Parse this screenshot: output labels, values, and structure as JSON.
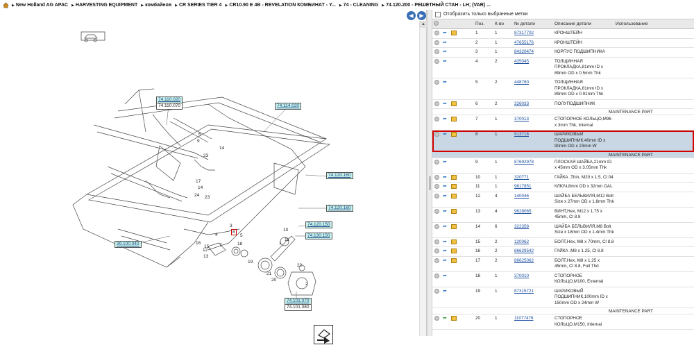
{
  "breadcrumb": [
    "New Holland AG APAC",
    "HARVESTING EQUIPMENT",
    "комбайнов",
    "CR SERIES TIER 4",
    "CR10.90 E 4B - REVELATION КОМБИНАТ - Y...",
    "74 - CLEANING",
    "74.120.200 - РЕШЕТНЫЙ СТАН - LH; (VAR) ..."
  ],
  "filter_label": "Отобразить только выбранные метки",
  "columns": {
    "pos": "Поз.",
    "qty": "К-во",
    "pn": "№ детали",
    "desc": "Описание детали",
    "use": "Использование"
  },
  "maintenance_label": "MAINTENANCE PART",
  "parts": [
    {
      "pos": "1",
      "qty": "1",
      "pn": "87317702",
      "desc": "КРОНШТЕЙН",
      "arrow": "blue",
      "box": true,
      "mp": false
    },
    {
      "pos": "2",
      "qty": "1",
      "pn": "47655176",
      "desc": "КРОНШТЕЙН",
      "arrow": "blue",
      "box": false,
      "mp": false
    },
    {
      "pos": "3",
      "qty": "1",
      "pn": "84320474",
      "desc": "КОРПУС ПОДШИПНИКА",
      "arrow": "blue",
      "box": false,
      "mp": false
    },
    {
      "pos": "4",
      "qty": "2",
      "pn": "435045",
      "desc": "ТОЛЩИННАЯ ПРОКЛАДКА,81mm ID x 89mm OD x 0.5mm Thk",
      "arrow": "blue",
      "box": false,
      "mp": false
    },
    {
      "pos": "5",
      "qty": "2",
      "pn": "448780",
      "desc": "ТОЛЩИННАЯ ПРОКЛАДКА,81mm ID x 89mm OD x 0.91mm Thk",
      "arrow": "blue",
      "box": false,
      "mp": false
    },
    {
      "pos": "6",
      "qty": "2",
      "pn": "326033",
      "desc": "ПОЛУПОДШИПНИК",
      "arrow": "blue",
      "box": true,
      "mp": true
    },
    {
      "pos": "7",
      "qty": "1",
      "pn": "370013",
      "desc": "СТОПОРНОЕ КОЛЬЦО,M96 x 3mm Thk, Internal",
      "arrow": "blue",
      "box": true,
      "mp": false
    },
    {
      "pos": "8",
      "qty": "1",
      "pn": "913716",
      "desc": "ШАРИКОВЫЙ ПОДШИПНИК,40mm ID x 90mm OD x 23mm W",
      "arrow": "blue",
      "box": true,
      "mp": true,
      "selected": true
    },
    {
      "pos": "9",
      "qty": "1",
      "pn": "87692978",
      "desc": "ПЛОСКАЯ ШАЙБА,21mm ID x 45mm OD x 3.05mm Thk",
      "arrow": "blue",
      "box": false,
      "mp": false
    },
    {
      "pos": "10",
      "qty": "1",
      "pn": "320771",
      "desc": "ГАЙКА ,Thin, M20 x 1.5, Cl 04",
      "arrow": "blue",
      "box": true,
      "mp": false
    },
    {
      "pos": "11",
      "qty": "1",
      "pn": "9817851",
      "desc": "КЛЮЧ,8mm OD x 32mm OAL",
      "arrow": "blue",
      "box": true,
      "mp": false
    },
    {
      "pos": "12",
      "qty": "4",
      "pn": "140046",
      "desc": "ШАЙБА БЕЛЬВИЛЯ,M12 Bolt Size x 27mm OD x 1.8mm Thk",
      "arrow": "blue",
      "box": true,
      "mp": false
    },
    {
      "pos": "13",
      "qty": "4",
      "pn": "9628065",
      "desc": "ВИНТ,Hex, M12 x 1.75 x 45mm, Cl 8.8",
      "arrow": "blue",
      "box": true,
      "mp": false
    },
    {
      "pos": "14",
      "qty": "6",
      "pn": "322358",
      "desc": "ШАЙБА БЕЛЬВИЛЯ,M8 Bolt Size x 18mm OD x 1.4mm Thk",
      "arrow": "blue",
      "box": true,
      "mp": false
    },
    {
      "pos": "15",
      "qty": "2",
      "pn": "120062",
      "desc": "БОЛТ,Hex, M8 x 70mm, Cl 8.8",
      "arrow": "blue",
      "box": true,
      "mp": false
    },
    {
      "pos": "16",
      "qty": "2",
      "pn": "86629542",
      "desc": "ГАЙКА ,M8 x 1.25, Cl 8.8",
      "arrow": "blue",
      "box": true,
      "mp": false
    },
    {
      "pos": "17",
      "qty": "2",
      "pn": "86625062",
      "desc": "БОЛТ,Hex, M8 x 1.25 x 45mm, Cl 8.8, Full Thd",
      "arrow": "blue",
      "box": true,
      "mp": false
    },
    {
      "pos": "18",
      "qty": "1",
      "pn": "370010",
      "desc": "СТОПОРНОЕ КОЛЬЦО,M100, External",
      "arrow": "blue",
      "box": false,
      "mp": false
    },
    {
      "pos": "19",
      "qty": "1",
      "pn": "87315721",
      "desc": "ШАРИКОВЫЙ ПОДШИПНИК,100mm ID x 150mm OD x 24mm W",
      "arrow": "blue",
      "box": false,
      "mp": true
    },
    {
      "pos": "20",
      "qty": "1",
      "pn": "11077476",
      "desc": "СТОПОРНОЕ КОЛЬЦО,M150, Internal",
      "arrow": "green",
      "box": true,
      "mp": false
    }
  ],
  "diagram": {
    "refs": {
      "r1": "74.110.020",
      "r1b": "74.110.070",
      "r2": "74.114.020",
      "r3": "74.120.160",
      "r4": "74.120.160",
      "r5": "74.120.150",
      "r6": "74.130.150",
      "r7": "39.100.040",
      "r8": "74.101.070",
      "r8b": "74.101.080"
    },
    "nums": {
      "n6": "6",
      "n9": "9",
      "n14": "14",
      "n23": "23",
      "n17": "17",
      "n14b": "14",
      "n24": "24",
      "n23b": "23",
      "n3": "3",
      "n8": "8",
      "n4": "4",
      "n5": "5",
      "n7": "7",
      "n18": "18",
      "n10": "10",
      "n11": "11",
      "n16": "16",
      "n15": "15",
      "n12": "12",
      "n13": "13",
      "n19": "19",
      "n21": "21",
      "n20": "20",
      "n22": "22",
      "n1": "1",
      "n2": "2"
    }
  }
}
